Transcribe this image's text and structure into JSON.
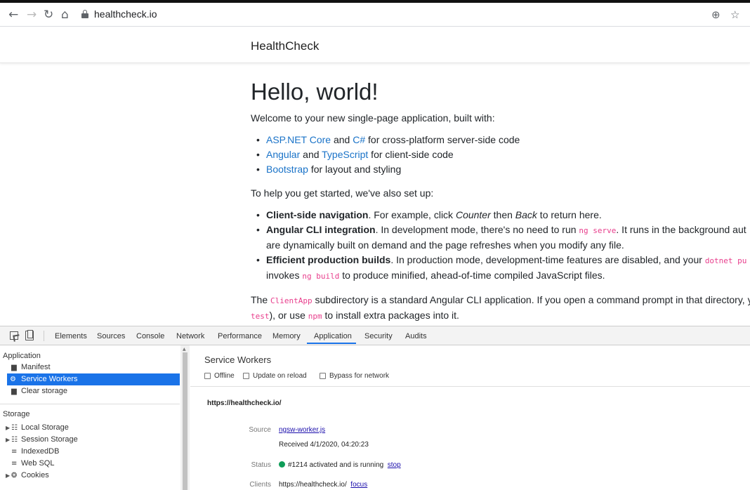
{
  "browser": {
    "url": "healthcheck.io",
    "icons": [
      "back-icon",
      "forward-icon",
      "reload-icon",
      "home-icon",
      "lock-icon",
      "add-icon",
      "star-icon"
    ]
  },
  "page": {
    "brand": "HealthCheck",
    "heading": "Hello, world!",
    "intro": "Welcome to your new single-page application, built with:",
    "built_with": [
      {
        "a": "ASP.NET Core",
        "and": " and ",
        "b": "C#",
        "rest": " for cross-platform server-side code"
      },
      {
        "a": "Angular",
        "and": " and ",
        "b": "TypeScript",
        "rest": " for client-side code"
      },
      {
        "a": "Bootstrap",
        "rest": " for layout and styling"
      }
    ],
    "setup_intro": "To help you get started, we've also set up:",
    "setup": {
      "nav_bold": "Client-side navigation",
      "nav_text1": ". For example, click ",
      "nav_em1": "Counter",
      "nav_text2": " then ",
      "nav_em2": "Back",
      "nav_text3": " to return here.",
      "cli_bold": "Angular CLI integration",
      "cli_text1": ". In development mode, there's no need to run ",
      "cli_code": "ng serve",
      "cli_text2": ". It runs in the background aut",
      "cli_line2": "are dynamically built on demand and the page refreshes when you modify any file.",
      "prod_bold": "Efficient production builds",
      "prod_text1": ". In production mode, development-time features are disabled, and your ",
      "prod_code": "dotnet pu",
      "prod_line2a": "invokes ",
      "prod_code2": "ng build",
      "prod_line2b": " to produce minified, ahead-of-time compiled JavaScript files."
    },
    "footer_a": "The ",
    "footer_code": "ClientApp",
    "footer_b": " subdirectory is a standard Angular CLI application. If you open a command prompt in that directory, yo",
    "footer_code2": "test",
    "footer_c": "), or use ",
    "footer_code3": "npm",
    "footer_d": " to install extra packages into it."
  },
  "devtools": {
    "tabs": [
      "Elements",
      "Sources",
      "Console",
      "Network",
      "Performance",
      "Memory",
      "Application",
      "Security",
      "Audits"
    ],
    "active_tab": "Application",
    "sidebar": {
      "application_header": "Application",
      "application_items": [
        "Manifest",
        "Service Workers",
        "Clear storage"
      ],
      "selected_item": "Service Workers",
      "storage_header": "Storage",
      "storage_items": [
        "Local Storage",
        "Session Storage",
        "IndexedDB",
        "Web SQL",
        "Cookies"
      ]
    },
    "service_workers": {
      "title": "Service Workers",
      "checkbox_offline": "Offline",
      "checkbox_update": "Update on reload",
      "checkbox_bypass": "Bypass for network",
      "origin": "https://healthcheck.io/",
      "source_label": "Source",
      "source_value": "ngsw-worker.js",
      "received": "Received 4/1/2020, 04:20:23",
      "status_label": "Status",
      "status_value": "#1214 activated and is running",
      "status_action": "stop",
      "clients_label": "Clients",
      "clients_value": "https://healthcheck.io/",
      "clients_action": "focus"
    }
  },
  "colors": {
    "accent": "#1a73e8",
    "link": "#1a73c8",
    "code": "#e83e8c",
    "status_ok": "#0f9d58"
  }
}
